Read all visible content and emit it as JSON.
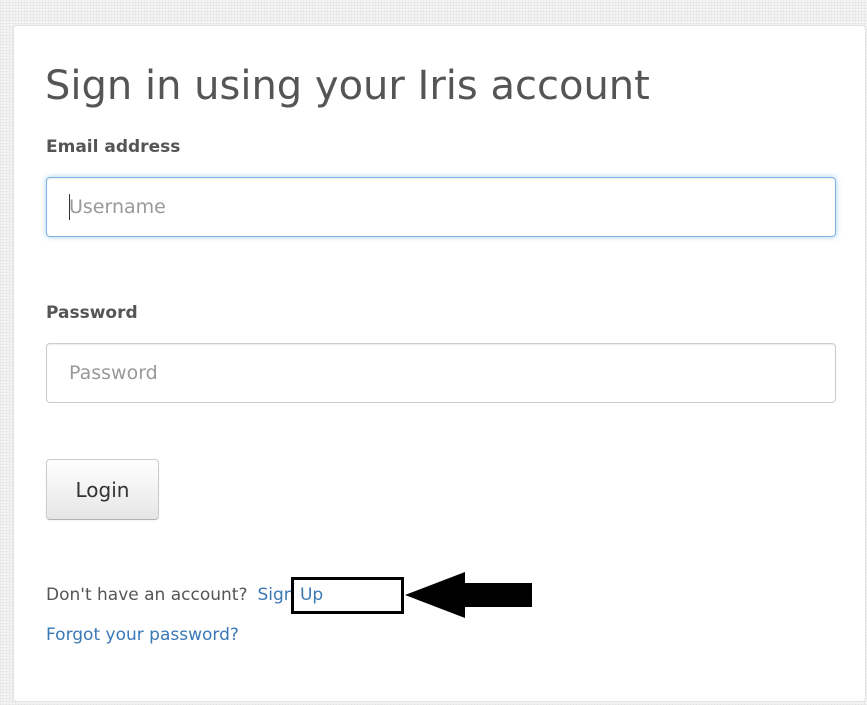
{
  "page": {
    "title": "Sign in using your Iris account"
  },
  "form": {
    "email_label": "Email address",
    "username_placeholder": "Username",
    "username_value": "",
    "password_label": "Password",
    "password_placeholder": "Password",
    "password_value": "",
    "login_label": "Login"
  },
  "links": {
    "signup_prompt": "Don't have an account?",
    "signup_label": "Sign Up",
    "forgot_label": "Forgot your password?"
  },
  "annotation": {
    "highlight_target": "Sign Up",
    "arrow_icon": "arrow-left-icon"
  },
  "colors": {
    "link": "#3a78b6",
    "focus_border": "#7fb5e4",
    "text": "#555555",
    "annotation": "#000000"
  }
}
